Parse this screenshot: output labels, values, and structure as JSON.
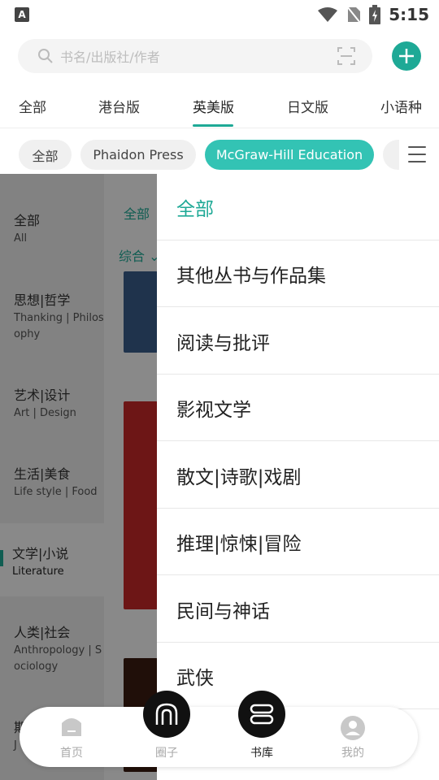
{
  "status_bar": {
    "time": "5:15",
    "app_badge": "A"
  },
  "search": {
    "placeholder": "书名/出版社/作者"
  },
  "top_tabs": [
    {
      "label": "全部"
    },
    {
      "label": "港台版"
    },
    {
      "label": "英美版",
      "active": true
    },
    {
      "label": "日文版"
    },
    {
      "label": "小语种"
    }
  ],
  "chips": [
    {
      "label": "全部"
    },
    {
      "label": "Phaidon Press"
    },
    {
      "label": "McGraw-Hill Education",
      "active": true
    }
  ],
  "categories": [
    {
      "zh": "全部",
      "en": "All"
    },
    {
      "zh": "思想|哲学",
      "en": "Thanking | Philosophy"
    },
    {
      "zh": "艺术|设计",
      "en": "Art | Design"
    },
    {
      "zh": "生活|美食",
      "en": "Life style | Food"
    },
    {
      "zh": "文学|小说",
      "en": "Literature",
      "active": true
    },
    {
      "zh": "人类|社会",
      "en": "Anthropology | Sociology"
    },
    {
      "zh": "期",
      "en": "J"
    }
  ],
  "sub_filter": {
    "all": "全部",
    "sort": "综合"
  },
  "drawer": {
    "items": [
      {
        "label": "全部",
        "active": true
      },
      {
        "label": "其他丛书与作品集"
      },
      {
        "label": "阅读与批评"
      },
      {
        "label": "影视文学"
      },
      {
        "label": "散文|诗歌|戏剧"
      },
      {
        "label": "推理|惊悚|冒险"
      },
      {
        "label": "民间与神话"
      },
      {
        "label": "武侠"
      }
    ]
  },
  "bottom_nav": [
    {
      "label": "首页",
      "icon": "home-icon"
    },
    {
      "label": "圈子",
      "icon": "circle-icon"
    },
    {
      "label": "书库",
      "icon": "library-icon",
      "active": true
    },
    {
      "label": "我的",
      "icon": "profile-icon"
    }
  ],
  "colors": {
    "accent": "#1ea996",
    "chip_active": "#33c3b4"
  }
}
